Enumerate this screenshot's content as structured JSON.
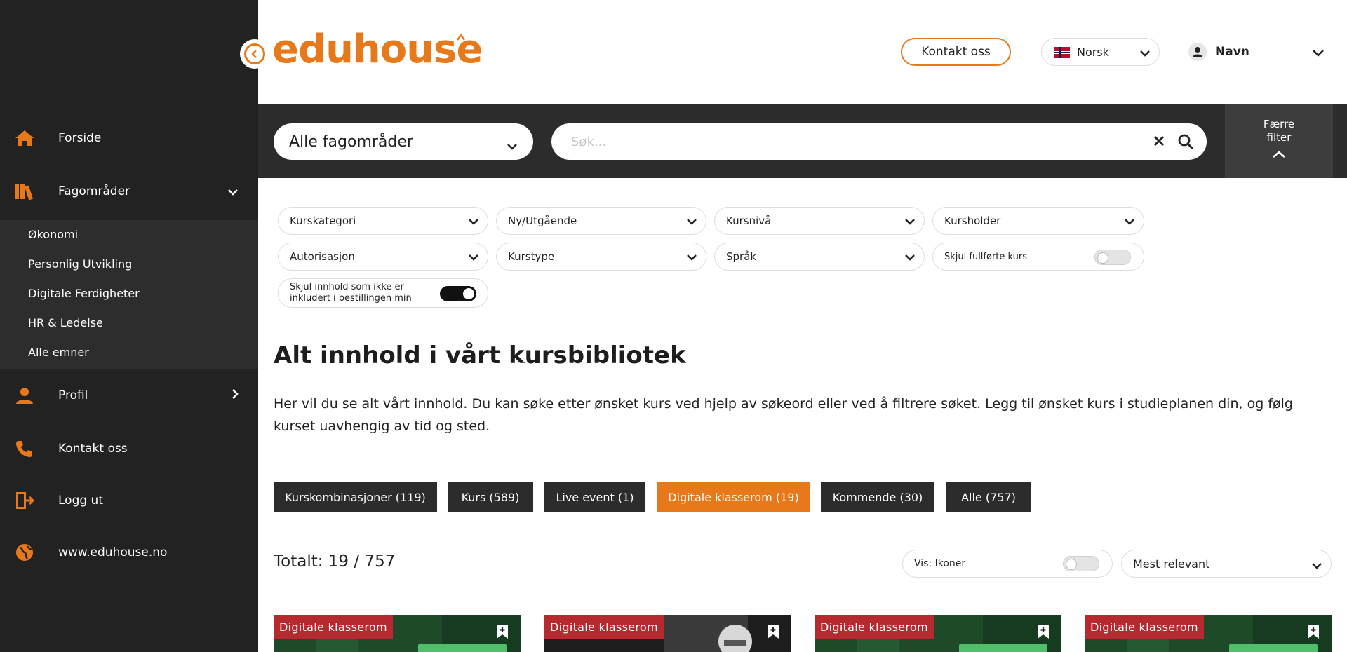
{
  "sidebar": {
    "items": [
      {
        "label": "Forside",
        "icon": "home-icon"
      },
      {
        "label": "Fagområder",
        "icon": "books-icon"
      },
      {
        "label": "Profil",
        "icon": "user-icon"
      },
      {
        "label": "Kontakt oss",
        "icon": "phone-icon"
      },
      {
        "label": "Logg ut",
        "icon": "logout-icon"
      },
      {
        "label": "www.eduhouse.no",
        "icon": "globe-icon"
      }
    ],
    "subitems": [
      "Økonomi",
      "Personlig Utvikling",
      "Digitale Ferdigheter",
      "HR & Ledelse",
      "Alle emner"
    ]
  },
  "header": {
    "logo": "eduhouse",
    "contact_label": "Kontakt oss",
    "language": "Norsk",
    "user_name": "Navn"
  },
  "searchbar": {
    "area_select": "Alle fagområder",
    "search_placeholder": "Søk...",
    "search_value": "",
    "fewer_filter_label": "Færre filter"
  },
  "filters": {
    "kurskategori": "Kurskategori",
    "ny_utgaende": "Ny/Utgående",
    "kursniva": "Kursnivå",
    "kursholder": "Kursholder",
    "autorisasjon": "Autorisasjon",
    "kurstype": "Kurstype",
    "sprak": "Språk",
    "skjul_fullforte": {
      "label": "Skjul fullførte kurs",
      "on": false
    },
    "skjul_innhold": {
      "label": "Skjul innhold som ikke er inkludert i bestillingen min",
      "on": true
    }
  },
  "main": {
    "title": "Alt innhold i vårt kursbibliotek",
    "description": "Her vil du se alt vårt innhold. Du kan søke etter ønsket kurs ved hjelp av søkeord eller ved å filtrere søket. Legg til ønsket kurs i studieplanen din, og følg kurset uavhengig av tid og sted.",
    "tabs": [
      {
        "label": "Kurskombinasjoner (119)",
        "active": false
      },
      {
        "label": "Kurs (589)",
        "active": false
      },
      {
        "label": "Live event (1)",
        "active": false
      },
      {
        "label": "Digitale klasserom (19)",
        "active": true
      },
      {
        "label": "Kommende (30)",
        "active": false
      },
      {
        "label": "Alle (757)",
        "active": false
      }
    ],
    "total": "Totalt: 19 / 757",
    "view_toggle": {
      "label": "Vis: Ikoner",
      "on": false
    },
    "sort": "Mest relevant"
  },
  "cards": [
    {
      "badge": "Digitale klasserom"
    },
    {
      "badge": "Digitale klasserom"
    },
    {
      "badge": "Digitale klasserom"
    },
    {
      "badge": "Digitale klasserom"
    }
  ],
  "colors": {
    "accent": "#e8791a",
    "sidebar": "#222222",
    "badge": "#b5292f",
    "tab": "#2c2c2c"
  }
}
